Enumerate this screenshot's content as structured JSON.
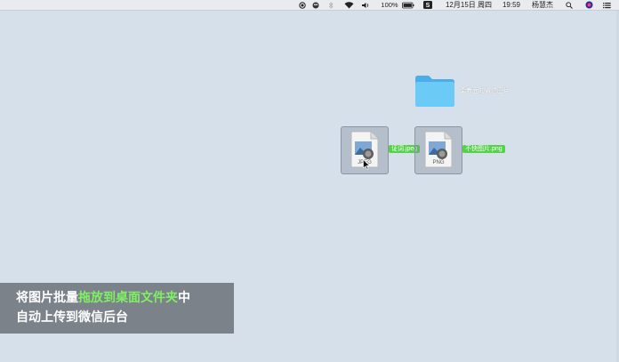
{
  "menubar": {
    "battery": "100%",
    "date": "12月15日 周四",
    "time": "19:59",
    "user": "杨慧杰"
  },
  "desktop": {
    "folder_label": "牵着面的微信图片",
    "file1_label": "证词.jpeg",
    "file1_ext": "JPEG",
    "file2_label": "不快图片.png",
    "file2_ext": "PNG"
  },
  "caption": {
    "line1_a": "将图片批量",
    "line1_highlight": "拖放到桌面文件夹",
    "line1_b": "中",
    "line2": "自动上传到微信后台"
  },
  "colors": {
    "desktop_bg": "#d6e0ea",
    "label_green": "#56d14b",
    "highlight_green": "#7ff063",
    "folder_blue": "#5ec0f4"
  },
  "icons": [
    "record-icon",
    "app-icon",
    "bluetooth-icon",
    "wifi-icon",
    "volume-icon",
    "battery-icon",
    "s-app-icon",
    "search-icon",
    "siri-icon",
    "list-icon",
    "folder-icon",
    "image-file-icon",
    "cursor-icon"
  ]
}
